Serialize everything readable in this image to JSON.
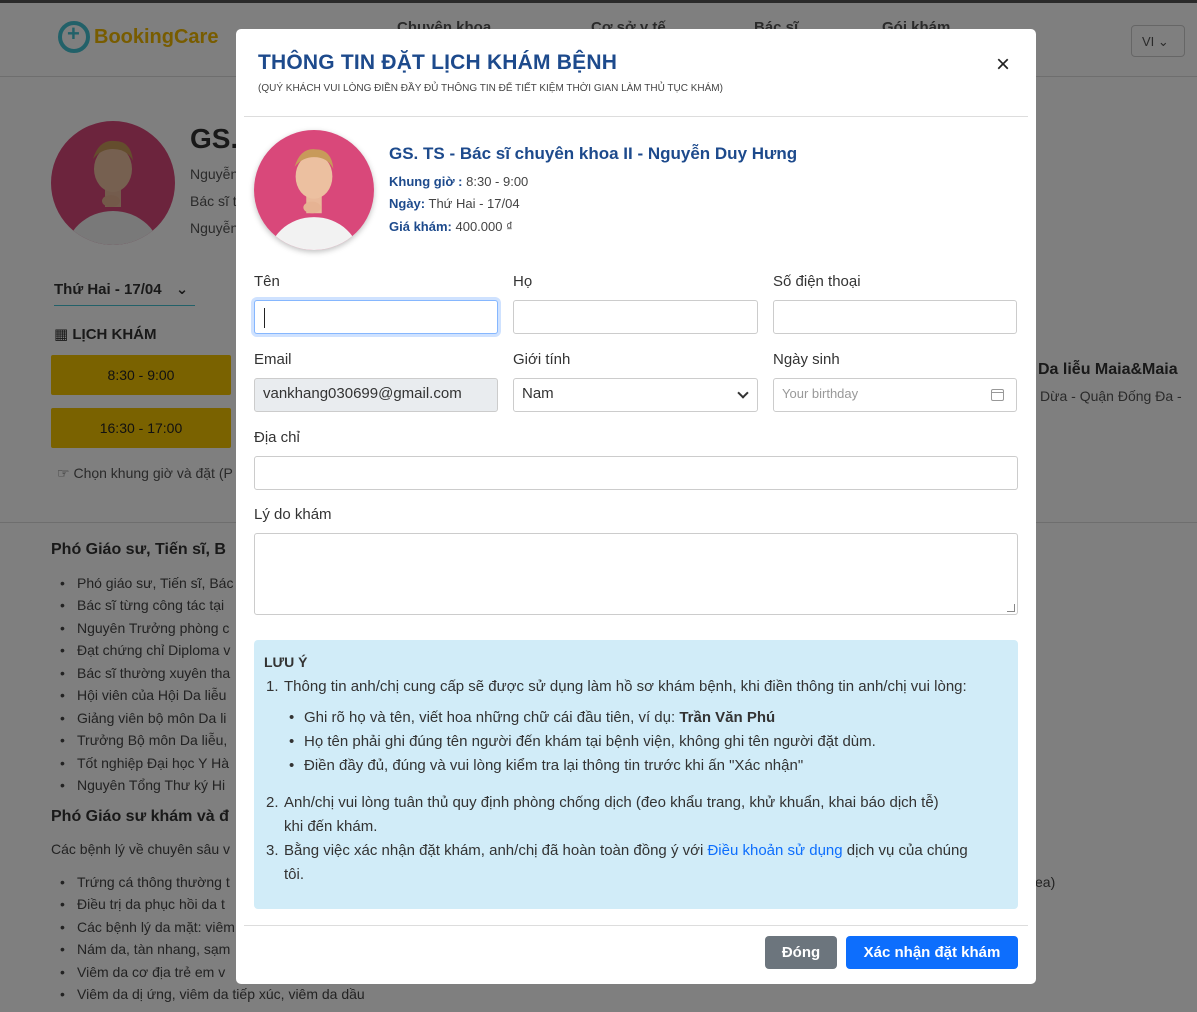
{
  "header": {
    "logo_text": "BookingCare",
    "nav": [
      "Chuyên khoa",
      "Cơ sở y tế",
      "Bác sĩ",
      "Gói khám"
    ],
    "lang": "VI"
  },
  "background": {
    "doctor_title": "GS.",
    "intro_lines": [
      "Nguyễn",
      "Bác sĩ t",
      "Nguyễn"
    ],
    "date_select": "Thứ Hai - 17/04",
    "schedule_label": "LỊCH KHÁM",
    "slots": [
      "8:30 - 9:00",
      "16:30 - 17:00"
    ],
    "hint": "Chọn khung giờ và đặt (P",
    "clinic_name": "Da liễu Maia&Maia",
    "clinic_addr": "Dừa - Quận Đống Đa -",
    "section1_title": "Phó Giáo sư, Tiến sĩ, B",
    "section1_items": [
      "Phó giáo sư, Tiến sĩ, Bác",
      "Bác sĩ từng công tác tại",
      "Nguyên Trưởng phòng c",
      "Đạt chứng chỉ Diploma v",
      "Bác sĩ thường xuyên tha",
      "Hội viên của Hội Da liễu",
      "Giảng viên bộ môn Da li",
      "Trưởng Bộ môn Da liễu,",
      "Tốt nghiệp Đại học Y Hà",
      "Nguyên Tổng Thư ký Hi"
    ],
    "section2_title": "Phó Giáo sư khám và đ",
    "section2_intro": "Các bệnh lý về chuyên sâu v",
    "section2_items": [
      "Trứng cá thông thường t",
      "Điều trị da phục hồi da t",
      "Các bệnh lý da mặt: viêm",
      "Nám da, tàn nhang, sạm",
      "Viêm da cơ địa trẻ em v",
      "Viêm da dị ứng, viêm da tiếp xúc, viêm da dầu"
    ],
    "right_fragment": "ea)"
  },
  "modal": {
    "title": "THÔNG TIN ĐẶT LỊCH KHÁM BỆNH",
    "subtitle": "(QUÝ KHÁCH VUI LÒNG ĐIỀN ĐẦY ĐỦ THÔNG TIN ĐỂ TIẾT KIỆM THỜI GIAN LÀM THỦ TỤC KHÁM)",
    "close_symbol": "×",
    "doctor": {
      "name": "GS. TS - Bác sĩ chuyên khoa II - Nguyễn Duy Hưng",
      "time_label": "Khung giờ :",
      "time_value": "8:30 - 9:00",
      "date_label": "Ngày:",
      "date_value": "Thứ Hai - 17/04",
      "price_label": "Giá khám:",
      "price_value": "400.000 ₫"
    },
    "form": {
      "first_name_label": "Tên",
      "first_name_value": "",
      "last_name_label": "Họ",
      "last_name_value": "",
      "phone_label": "Số điện thoại",
      "phone_value": "",
      "email_label": "Email",
      "email_value": "vankhang030699@gmail.com",
      "gender_label": "Giới tính",
      "gender_value": "Nam",
      "birthday_label": "Ngày sinh",
      "birthday_placeholder": "Your birthday",
      "address_label": "Địa chỉ",
      "address_value": "",
      "reason_label": "Lý do khám",
      "reason_value": ""
    },
    "note": {
      "title": "LƯU Ý",
      "item1": "Thông tin anh/chị cung cấp sẽ được sử dụng làm hồ sơ khám bệnh, khi điền thông tin anh/chị vui lòng:",
      "sub1_prefix": "Ghi rõ họ và tên, viết hoa những chữ cái đầu tiên, ví dụ:",
      "sub1_example": "Trần Văn Phú",
      "sub2": "Họ tên phải ghi đúng tên người đến khám tại bệnh viện, không ghi tên người đặt dùm.",
      "sub3": "Điền đầy đủ, đúng và vui lòng kiểm tra lại thông tin trước khi ấn \"Xác nhận\"",
      "item2_line1": "Anh/chị vui lòng tuân thủ quy định phòng chống dịch (đeo khẩu trang, khử khuẩn, khai báo dịch tễ)",
      "item2_line2": "khi đến khám.",
      "item3_prefix": "Bằng việc xác nhận đặt khám, anh/chị đã hoàn toàn đồng ý với",
      "item3_link": "Điều khoản sử dụng",
      "item3_suffix": "dịch vụ của chúng",
      "item3_line2": "tôi."
    },
    "buttons": {
      "close": "Đóng",
      "confirm": "Xác nhận đặt khám"
    }
  }
}
